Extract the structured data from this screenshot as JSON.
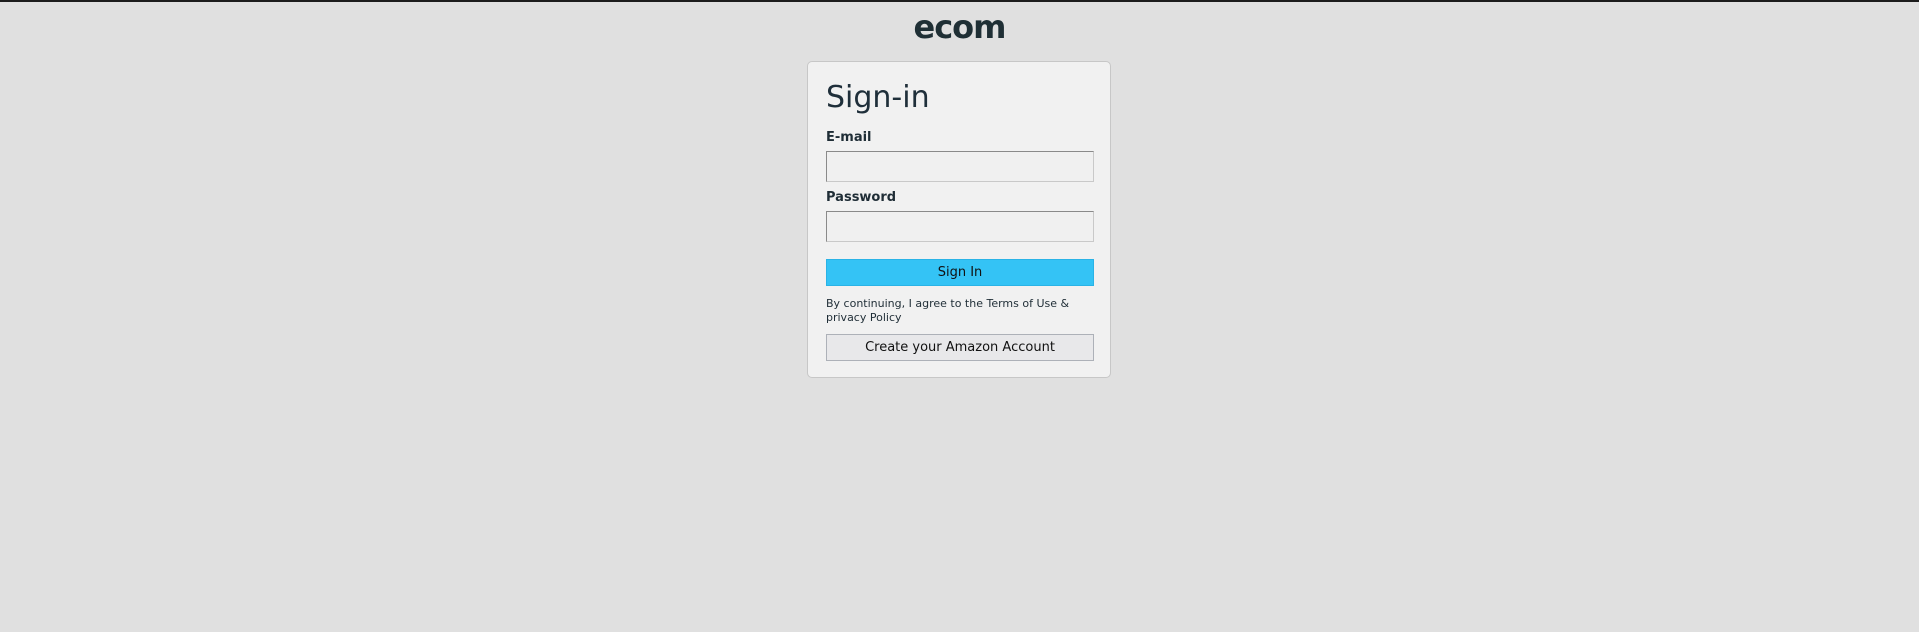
{
  "brand": {
    "logo_text": "ecom"
  },
  "signin": {
    "title": "Sign-in",
    "email_label": "E-mail",
    "email_value": "",
    "email_placeholder": "",
    "password_label": "Password",
    "password_value": "",
    "password_placeholder": "",
    "submit_label": "Sign In",
    "terms_text": "By continuing, I agree to the Terms of Use & privacy Policy",
    "create_account_label": "Create your Amazon Account"
  },
  "colors": {
    "background": "#e0e0e0",
    "card_background": "#f1f1f1",
    "primary_button": "#34c3f5",
    "secondary_button": "#e8e8ea",
    "text": "#1f2d36"
  }
}
